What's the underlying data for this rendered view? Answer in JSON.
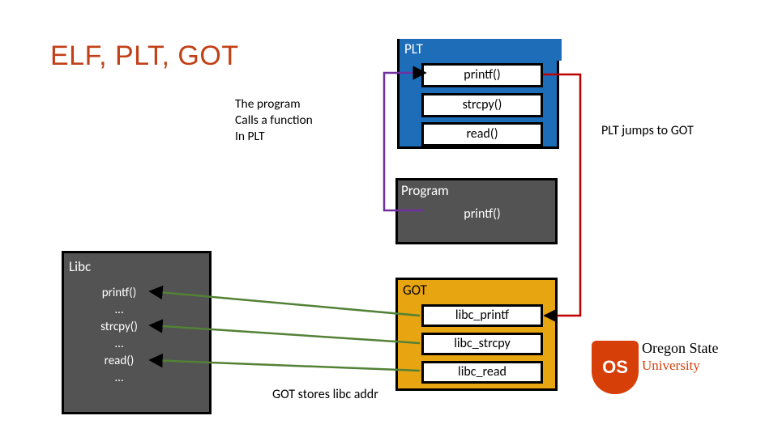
{
  "title": "ELF, PLT, GOT",
  "plt": {
    "label": "PLT",
    "rows": [
      "printf()",
      "strcpy()",
      "read()"
    ]
  },
  "program": {
    "label": "Program",
    "call": "printf()"
  },
  "got": {
    "label": "GOT",
    "rows": [
      "libc_printf",
      "libc_strcpy",
      "libc_read"
    ]
  },
  "libc": {
    "label": "Libc",
    "items": [
      "printf()",
      "…",
      "strcpy()",
      "…",
      "read()",
      "…"
    ]
  },
  "annotations": {
    "calls": "The program\nCalls a function\nIn PLT",
    "jumps": "PLT jumps to GOT",
    "stores": "GOT stores libc addr"
  },
  "logo": {
    "top": "Oregon State",
    "bottom": "University",
    "shield": "OS"
  },
  "colors": {
    "accent": "#c24018",
    "plt": "#1d6db8",
    "got": "#e8a512",
    "box": "#535353",
    "osu": "#d73f09"
  }
}
